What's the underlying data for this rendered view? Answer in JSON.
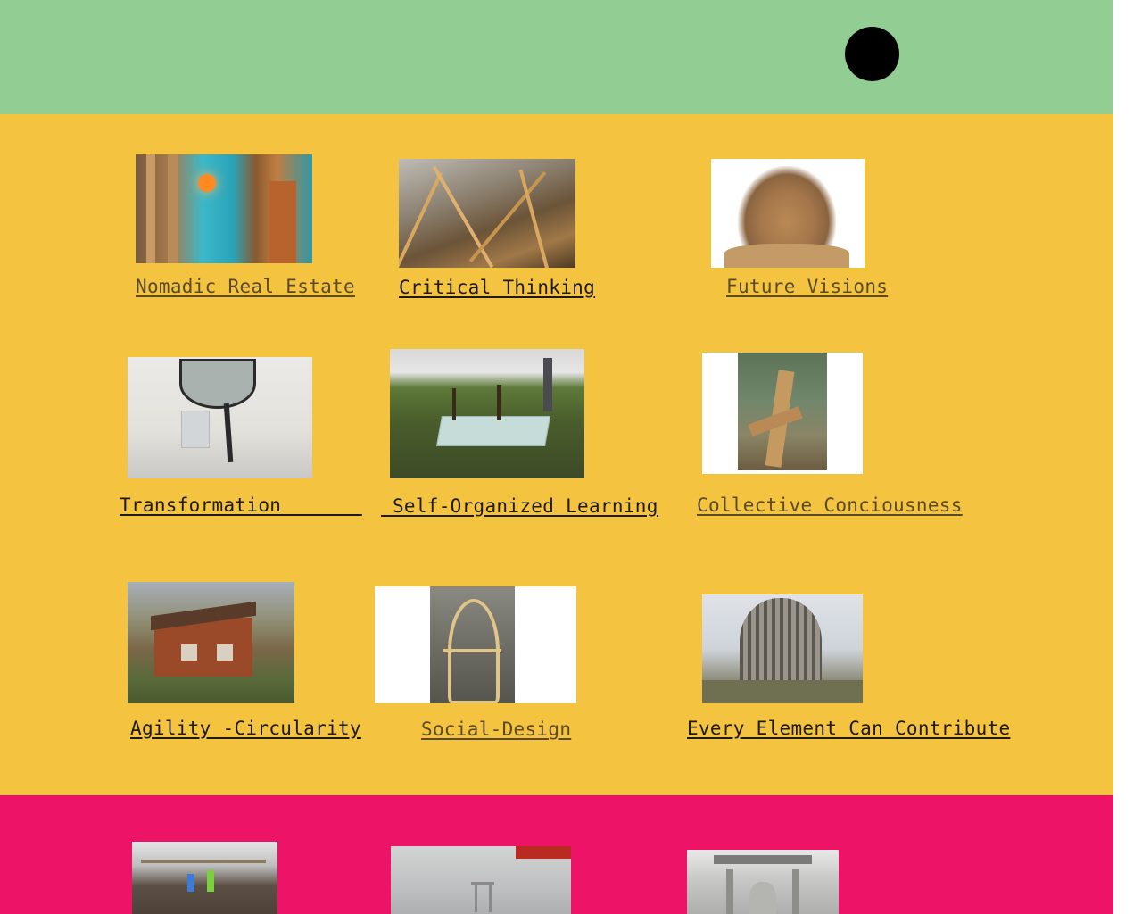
{
  "colors": {
    "header_bg": "#92cd94",
    "main_bg": "#f4c340",
    "footer_bg": "#ed1468",
    "menu_dot": "#000000",
    "link_text": "#1e1a12"
  },
  "header": {
    "menu_icon": "black-circle-menu-icon"
  },
  "projects": [
    {
      "label": "Nomadic Real Estate"
    },
    {
      "label": "Critical Thinking"
    },
    {
      "label": "Future Visions"
    },
    {
      "label": "Transformation       "
    },
    {
      "label": "_Self-Organized Learning"
    },
    {
      "label": "Collective Conciousness"
    },
    {
      "label": "Agility -Circularity"
    },
    {
      "label": "Social-Design"
    },
    {
      "label": "Every Element Can Contribute"
    }
  ],
  "footer_photos": [
    {
      "name": "scaffold-construction-photo"
    },
    {
      "name": "misty-torii-gate-photo"
    },
    {
      "name": "classical-facade-photo"
    }
  ]
}
